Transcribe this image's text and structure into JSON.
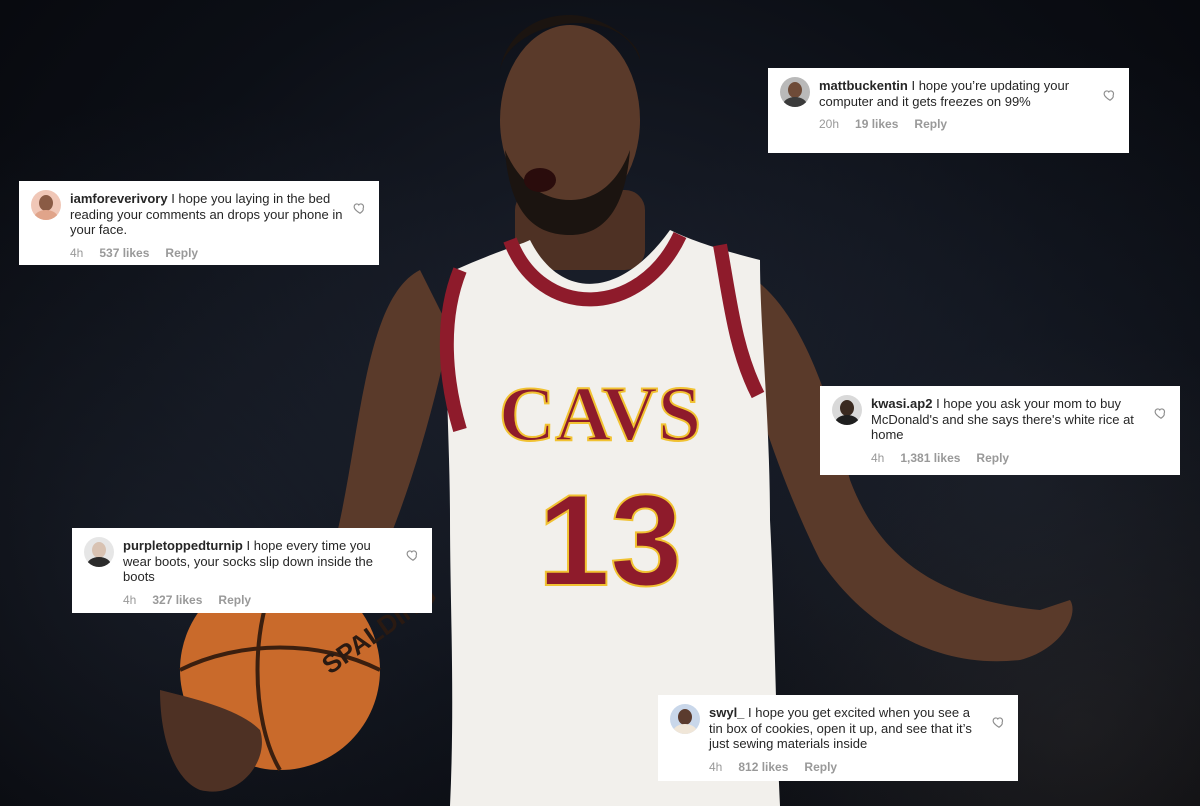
{
  "comments": [
    {
      "username": "mattbuckentin",
      "text": "I hope you’re updating your computer and it gets freezes on 99%",
      "time": "20h",
      "likes": "19 likes",
      "reply": "Reply"
    },
    {
      "username": "iamforeverivory",
      "text": "I hope you laying in the bed reading your comments an drops your phone in your face.",
      "time": "4h",
      "likes": "537 likes",
      "reply": "Reply"
    },
    {
      "username": "kwasi.ap2",
      "text": "I hope you ask your mom to buy McDonald's and she says there's white rice at home",
      "time": "4h",
      "likes": "1,381 likes",
      "reply": "Reply"
    },
    {
      "username": "purpletoppedturnip",
      "text": "I hope every time you wear boots, your socks slip down inside the boots",
      "time": "4h",
      "likes": "327 likes",
      "reply": "Reply"
    },
    {
      "username": "swyl_",
      "text": "I hope you get excited when you see a tin box of cookies, open it up, and see that it’s just sewing materials inside",
      "time": "4h",
      "likes": "812 likes",
      "reply": "Reply"
    }
  ],
  "jersey": {
    "team": "CAVS",
    "number": "13"
  },
  "basketball": {
    "brand": "SPALDING"
  },
  "colors": {
    "jersey_white": "#f2f0ec",
    "jersey_trim": "#8e1b2b",
    "jersey_gold": "#f1c232",
    "skin": "#5a3a2a",
    "ball": "#c96a2b",
    "meta_gray": "#999999",
    "username": "#262626"
  },
  "icons": {
    "heart": "heart-icon"
  }
}
